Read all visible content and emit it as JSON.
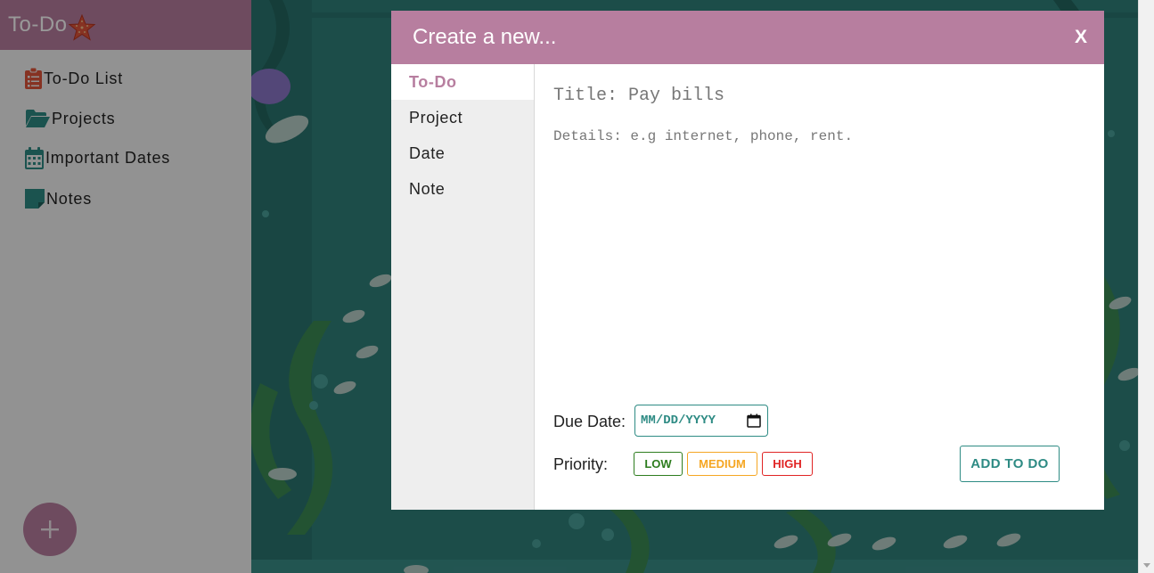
{
  "sidebar": {
    "brand": "To-Do",
    "items": [
      {
        "label": "To-Do List",
        "icon": "clipboard-list-icon"
      },
      {
        "label": "Projects",
        "icon": "folder-open-icon"
      },
      {
        "label": "Important Dates",
        "icon": "calendar-icon"
      },
      {
        "label": "Notes",
        "icon": "sticky-note-icon"
      }
    ],
    "fab_label": "+"
  },
  "modal": {
    "title": "Create a new...",
    "close_label": "X",
    "tabs": [
      {
        "label": "To-Do",
        "active": true
      },
      {
        "label": "Project",
        "active": false
      },
      {
        "label": "Date",
        "active": false
      },
      {
        "label": "Note",
        "active": false
      }
    ],
    "form": {
      "title_placeholder": "Title: Pay bills",
      "details_placeholder": "Details: e.g internet, phone, rent.",
      "due_date_label": "Due Date:",
      "due_date_value": "MM/DD/YYYY",
      "priority_label": "Priority:",
      "priorities": [
        "LOW",
        "MEDIUM",
        "HIGH"
      ],
      "submit_label": "ADD TO DO"
    }
  },
  "colors": {
    "accent": "#b77e9f",
    "teal": "#2e8b84",
    "low": "#2e7d1f",
    "medium": "#f5a623",
    "high": "#e02424"
  }
}
